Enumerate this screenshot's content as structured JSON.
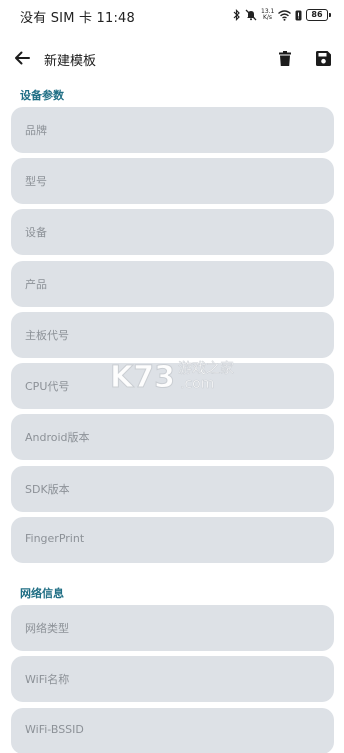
{
  "status_bar": {
    "left_text": "没有 SIM 卡 11:48",
    "net_speed_value": "13.1",
    "net_speed_unit": "K/s",
    "battery": "86",
    "icons": [
      "bluetooth-icon",
      "mute-icon",
      "wifi-icon",
      "alert-icon",
      "battery-icon"
    ]
  },
  "app_bar": {
    "title": "新建模板",
    "icons": [
      "back-arrow-icon",
      "delete-icon",
      "save-icon"
    ]
  },
  "sections": [
    {
      "title": "设备参数",
      "fields": [
        {
          "placeholder": "品牌"
        },
        {
          "placeholder": "型号"
        },
        {
          "placeholder": "设备"
        },
        {
          "placeholder": "产品"
        },
        {
          "placeholder": "主板代号"
        },
        {
          "placeholder": "CPU代号"
        },
        {
          "placeholder": "Android版本"
        },
        {
          "placeholder": "SDK版本"
        },
        {
          "placeholder": "FingerPrint"
        }
      ]
    },
    {
      "title": "网络信息",
      "fields": [
        {
          "placeholder": "网络类型"
        },
        {
          "placeholder": "WiFi名称"
        },
        {
          "placeholder": "WiFi-BSSID"
        }
      ]
    }
  ],
  "watermark": {
    "logo_text": "K73",
    "site_text": "游戏之家",
    "domain_text": ".com"
  },
  "colors": {
    "section_title": "#1f6e84",
    "field_bg": "#dde1e6",
    "placeholder": "#8c9197",
    "watermark": "#ffffff"
  }
}
